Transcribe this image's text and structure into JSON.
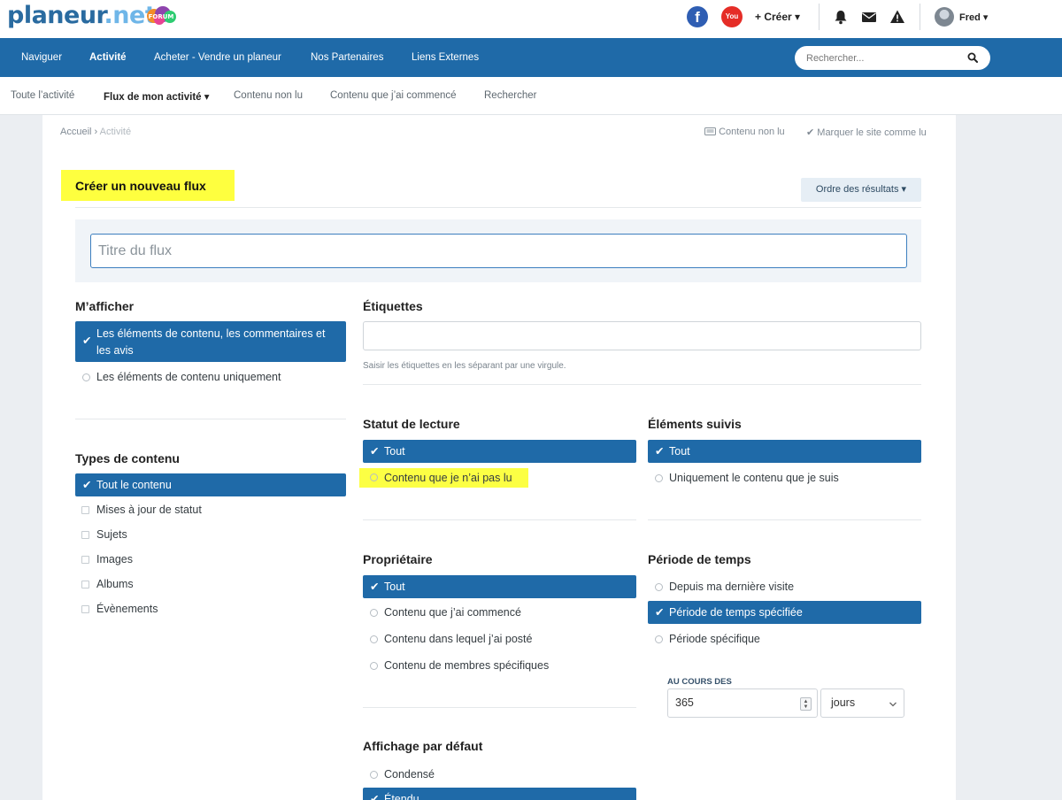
{
  "header": {
    "logo_main": "planeur.net",
    "logo_badge": "FORUM",
    "create_label": "+ Créer",
    "user_name": "Fred"
  },
  "nav": {
    "items": [
      "Naviguer",
      "Activité",
      "Acheter - Vendre un planeur",
      "Nos Partenaires",
      "Liens Externes"
    ],
    "active": "Activité",
    "search_placeholder": "Rechercher..."
  },
  "subnav": {
    "items": [
      "Toute l’activité",
      "Flux de mon activité",
      "Contenu non lu",
      "Contenu que j’ai commencé",
      "Rechercher"
    ],
    "active": "Flux de mon activité"
  },
  "breadcrumb": {
    "home": "Accueil",
    "current": "Activité"
  },
  "breadcrumb_actions": {
    "unread": "Contenu non lu",
    "mark_read": "Marquer le site comme lu"
  },
  "page": {
    "title": "Créer un nouveau flux",
    "sort_label": "Ordre des résultats",
    "title_placeholder": "Titre du flux"
  },
  "show_me": {
    "heading": "M’afficher",
    "options": [
      "Les éléments de contenu, les commentaires et les avis",
      "Les éléments de contenu uniquement"
    ],
    "selected": 0
  },
  "tags": {
    "heading": "Étiquettes",
    "value": "",
    "hint": "Saisir les étiquettes en les séparant par une virgule."
  },
  "content_types": {
    "heading": "Types de contenu",
    "options": [
      "Tout le contenu",
      "Mises à jour de statut",
      "Sujets",
      "Images",
      "Albums",
      "Évènements"
    ],
    "selected": 0
  },
  "read_status": {
    "heading": "Statut de lecture",
    "options": [
      "Tout",
      "Contenu que je n’ai pas lu"
    ],
    "selected": 0
  },
  "followed": {
    "heading": "Éléments suivis",
    "options": [
      "Tout",
      "Uniquement le contenu que je suis"
    ],
    "selected": 0
  },
  "owner": {
    "heading": "Propriétaire",
    "options": [
      "Tout",
      "Contenu que j’ai commencé",
      "Contenu dans lequel j’ai posté",
      "Contenu de membres spécifiques"
    ],
    "selected": 0
  },
  "time_period": {
    "heading": "Période de temps",
    "options": [
      "Depuis ma dernière visite",
      "Période de temps spécifiée",
      "Période spécifique"
    ],
    "selected": 1,
    "within_label": "AU COURS DES",
    "amount": "365",
    "unit": "jours"
  },
  "default_view": {
    "heading": "Affichage par défaut",
    "options": [
      "Condensé",
      "Étendu"
    ],
    "selected": 1
  },
  "colors": {
    "primary": "#1f6aa8",
    "highlight": "#feff3f"
  }
}
